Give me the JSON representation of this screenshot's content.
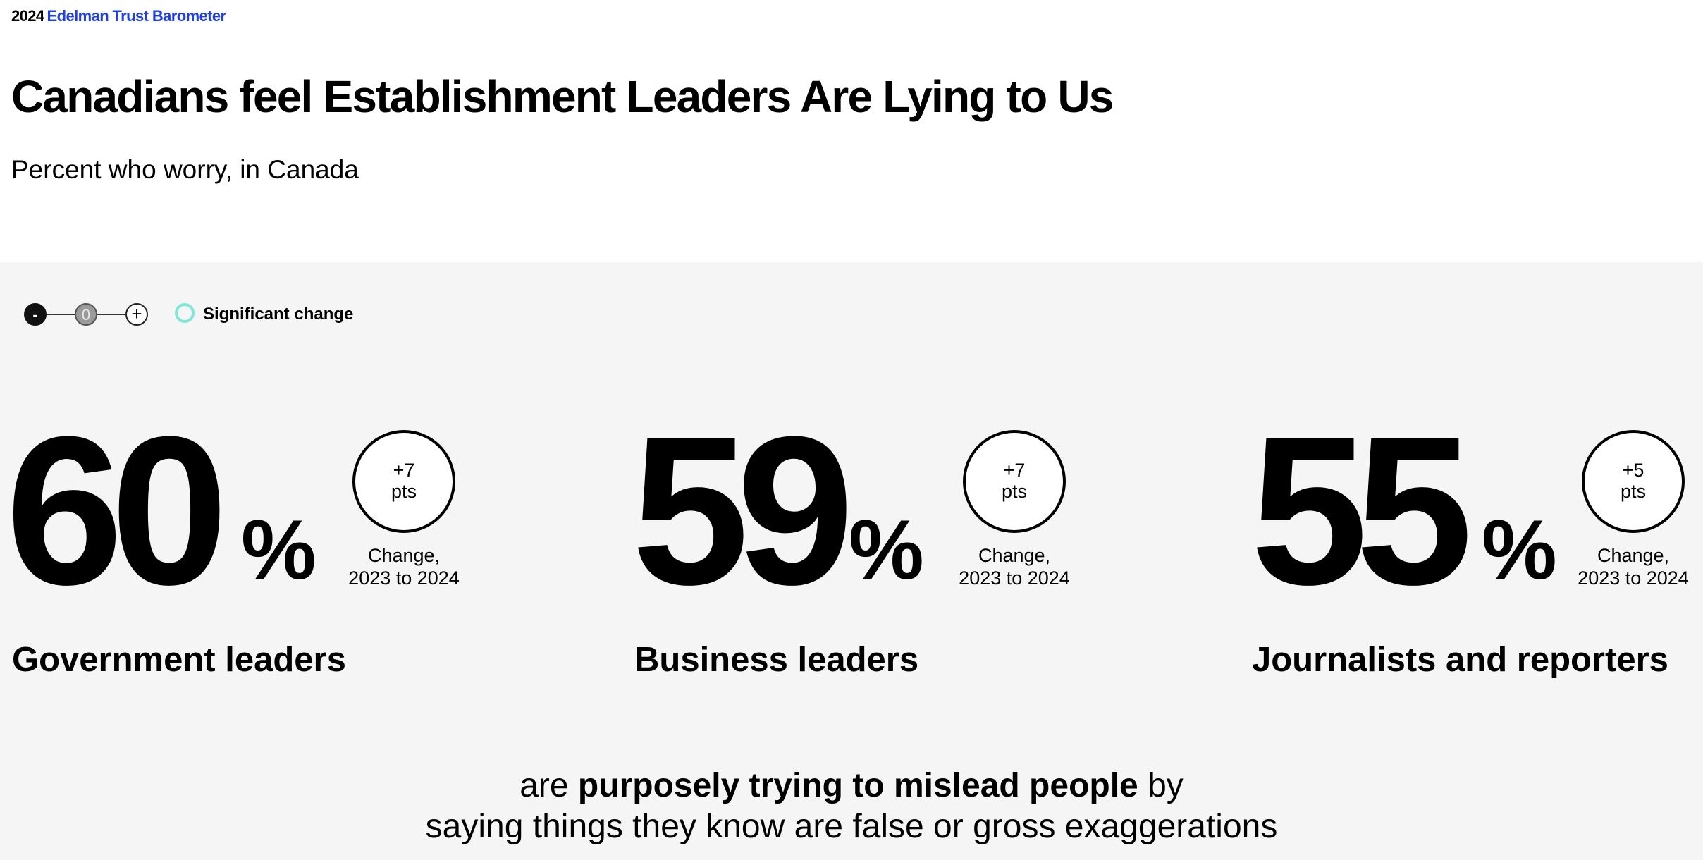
{
  "header": {
    "year": "2024",
    "brand": "Edelman Trust Barometer"
  },
  "title": "Canadians feel Establishment Leaders Are Lying to Us",
  "subtitle": "Percent who worry, in Canada",
  "legend": {
    "minus": "-",
    "zero": "0",
    "plus": "+",
    "significant_label": "Significant change"
  },
  "colors": {
    "brand_blue": "#1e3ef0",
    "significant_ring": "#7ee8d6",
    "panel_bg": "#f5f5f5"
  },
  "chart_data": {
    "type": "bar",
    "title": "Canadians feel Establishment Leaders Are Lying to Us",
    "subtitle": "Percent who worry, in Canada",
    "categories": [
      "Government leaders",
      "Business leaders",
      "Journalists and reporters"
    ],
    "values": [
      60,
      59,
      55
    ],
    "unit": "%",
    "change_2023_to_2024": [
      "+7",
      "+7",
      "+5"
    ],
    "change_unit": "pts",
    "change_caption": [
      "Change,",
      "2023 to 2024"
    ],
    "stats": [
      {
        "value": "60",
        "unit": "%",
        "change": "+7",
        "change_unit": "pts",
        "label": "Government leaders"
      },
      {
        "value": "59",
        "unit": "%",
        "change": "+7",
        "change_unit": "pts",
        "label": "Business leaders"
      },
      {
        "value": "55",
        "unit": "%",
        "change": "+5",
        "change_unit": "pts",
        "label": "Journalists and reporters"
      }
    ]
  },
  "statement": {
    "prefix": "are",
    "emphasis": "purposely trying to mislead people",
    "suffix": "by",
    "line2": "saying things they know are false or gross exaggerations"
  }
}
